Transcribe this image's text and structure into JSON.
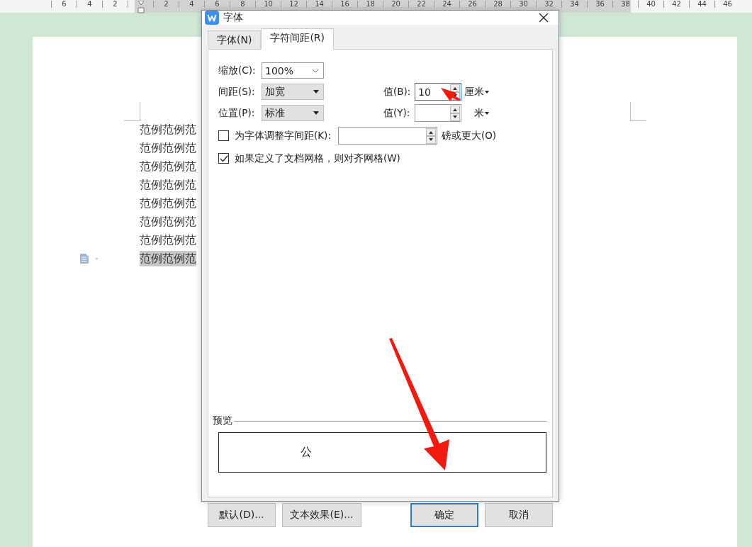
{
  "ruler": {
    "marks": [
      {
        "kind": "number",
        "text": "6"
      },
      {
        "kind": "number",
        "text": "4"
      },
      {
        "kind": "number",
        "text": "2"
      },
      {
        "kind": "indent"
      },
      {
        "kind": "number",
        "text": "2"
      },
      {
        "kind": "number",
        "text": "4"
      },
      {
        "kind": "number",
        "text": "6"
      },
      {
        "kind": "number",
        "text": "8"
      },
      {
        "kind": "number",
        "text": "10"
      },
      {
        "kind": "number",
        "text": "12"
      },
      {
        "kind": "number",
        "text": "14"
      },
      {
        "kind": "number",
        "text": "16"
      },
      {
        "kind": "number",
        "text": "18"
      },
      {
        "kind": "number",
        "text": "20"
      },
      {
        "kind": "number",
        "text": "22"
      },
      {
        "kind": "number",
        "text": "24"
      },
      {
        "kind": "number",
        "text": "26"
      },
      {
        "kind": "number",
        "text": "28"
      },
      {
        "kind": "number",
        "text": "30"
      },
      {
        "kind": "number",
        "text": "32"
      },
      {
        "kind": "number",
        "text": "34"
      },
      {
        "kind": "number",
        "text": "36"
      },
      {
        "kind": "number",
        "text": "38"
      },
      {
        "kind": "number",
        "text": "40"
      },
      {
        "kind": "number",
        "text": "42"
      },
      {
        "kind": "number",
        "text": "44"
      },
      {
        "kind": "number",
        "text": "46"
      }
    ]
  },
  "document": {
    "lines": [
      {
        "text": "范例范例范",
        "selected": false
      },
      {
        "text": "范例范例范",
        "selected": false
      },
      {
        "text": "范例范例范",
        "selected": false
      },
      {
        "text": "范例范例范",
        "selected": false
      },
      {
        "text": "范例范例范",
        "selected": false
      },
      {
        "text": "范例范例范",
        "selected": false
      },
      {
        "text": "范例范例范",
        "selected": false
      },
      {
        "text": "范例范例范",
        "selected": true
      }
    ]
  },
  "dialog": {
    "title": "字体",
    "tabs": [
      {
        "label": "字体(N)",
        "selected": false
      },
      {
        "label": "字符间距(R)",
        "selected": true
      }
    ],
    "rows": [
      {
        "label": "缩放(C):",
        "kind": "combo",
        "value": "100%"
      },
      {
        "label": "间距(S):",
        "kind": "list",
        "value": "加宽",
        "value_label": "值(B):",
        "amount": "10",
        "focused": true,
        "unit": "厘米"
      },
      {
        "label": "位置(P):",
        "kind": "list",
        "value": "标准",
        "value_label": "值(Y):",
        "focused": false,
        "unit": "米"
      }
    ],
    "kerning": {
      "label": "为字体调整字间距(K):",
      "checked": false,
      "suffix": "磅或更大(O)"
    },
    "grid": {
      "label": "如果定义了文档网格，则对齐网格(W)",
      "checked": true
    },
    "preview": {
      "label": "预览",
      "sample": "公"
    },
    "buttons": [
      {
        "label": "默认(D)...",
        "default": false
      },
      {
        "label": "文本效果(E)...",
        "default": false
      },
      {
        "label": "确定",
        "default": true
      },
      {
        "label": "取消",
        "default": false
      }
    ]
  }
}
